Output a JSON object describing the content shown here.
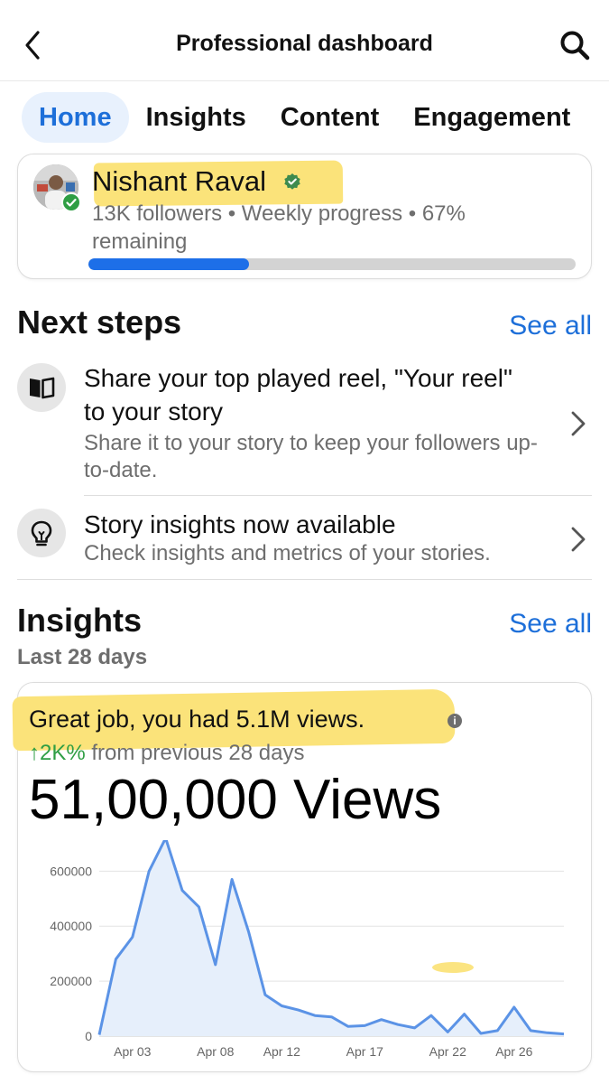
{
  "header": {
    "title": "Professional dashboard"
  },
  "tabs": [
    {
      "label": "Home",
      "active": true
    },
    {
      "label": "Insights",
      "active": false
    },
    {
      "label": "Content",
      "active": false
    },
    {
      "label": "Engagement",
      "active": false
    }
  ],
  "profile": {
    "name": "Nishant Raval",
    "stats": "13K followers • Weekly progress • 67% remaining",
    "progress_fraction": 0.33
  },
  "next_steps": {
    "title": "Next steps",
    "see_all": "See all",
    "items": [
      {
        "title": "Share your top played reel, \"Your reel\" to your story",
        "subtitle": "Share it to your story to keep your followers up-to-date.",
        "icon": "book-icon"
      },
      {
        "title": "Story insights now available",
        "subtitle": "Check insights and metrics of your stories.",
        "icon": "lightbulb-icon"
      }
    ]
  },
  "insights": {
    "title": "Insights",
    "see_all": "See all",
    "period": "Last 28 days",
    "headline": "Great job, you had 5.1M views.",
    "info_glyph": "i",
    "change_value": "↑2K%",
    "change_text": " from previous 28 days",
    "big_views": "51,00,000 Views"
  },
  "colors": {
    "accent": "#1d6fd9",
    "progress": "#1d6fe8",
    "highlight": "#fbe37a",
    "positive": "#2f9e44",
    "line": "#5b93e6",
    "area": "#e6effb"
  },
  "chart_data": {
    "type": "area",
    "x": [
      "Apr 01",
      "Apr 02",
      "Apr 03",
      "Apr 04",
      "Apr 05",
      "Apr 06",
      "Apr 07",
      "Apr 08",
      "Apr 09",
      "Apr 10",
      "Apr 11",
      "Apr 12",
      "Apr 13",
      "Apr 14",
      "Apr 15",
      "Apr 16",
      "Apr 17",
      "Apr 18",
      "Apr 19",
      "Apr 20",
      "Apr 21",
      "Apr 22",
      "Apr 23",
      "Apr 24",
      "Apr 25",
      "Apr 26",
      "Apr 27",
      "Apr 28",
      "Apr 29"
    ],
    "values": [
      5000,
      280000,
      360000,
      600000,
      720000,
      530000,
      470000,
      260000,
      570000,
      380000,
      150000,
      110000,
      95000,
      75000,
      70000,
      35000,
      38000,
      60000,
      42000,
      30000,
      75000,
      15000,
      80000,
      10000,
      20000,
      105000,
      20000,
      12000,
      8000
    ],
    "x_tick_labels": [
      "Apr 03",
      "Apr 08",
      "Apr 12",
      "Apr 17",
      "Apr 22",
      "Apr 26"
    ],
    "y_tick_labels": [
      "0",
      "200000",
      "400000",
      "600000"
    ],
    "y_ticks": [
      0,
      200000,
      400000,
      600000
    ],
    "ylim": [
      0,
      680000
    ],
    "grid": true,
    "legend": "none"
  }
}
